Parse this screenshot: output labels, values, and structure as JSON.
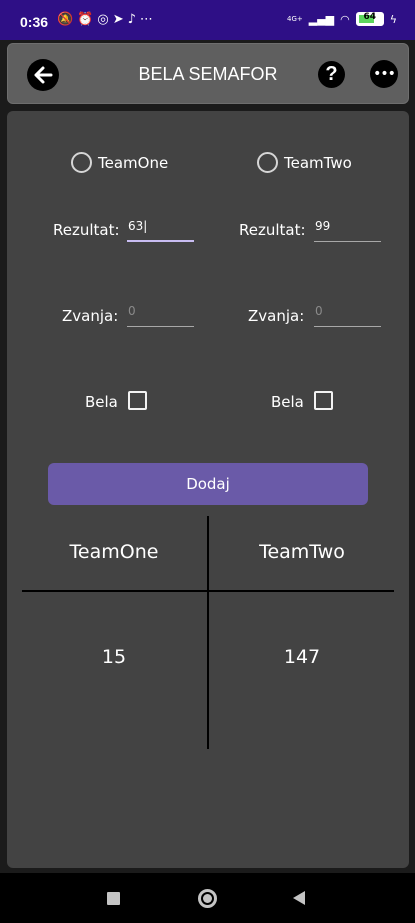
{
  "status_bar": {
    "time": "0:36",
    "icons": [
      "mute-icon",
      "alarm-icon",
      "whatsapp-icon",
      "telegram-icon",
      "notification-icon",
      "more-notifications-icon"
    ],
    "network": "4G+",
    "battery": "64"
  },
  "appbar": {
    "title": "BELA SEMAFOR",
    "help_glyph": "?",
    "more_glyph": "•••"
  },
  "form": {
    "team_one": {
      "name": "TeamOne",
      "rezultat_label": "Rezultat:",
      "rezultat_value": "63",
      "zvanja_label": "Zvanja:",
      "zvanja_placeholder": "0",
      "bela_label": "Bela"
    },
    "team_two": {
      "name": "TeamTwo",
      "rezultat_label": "Rezultat:",
      "rezultat_value": "99",
      "zvanja_label": "Zvanja:",
      "zvanja_placeholder": "0",
      "bela_label": "Bela"
    },
    "add_button": "Dodaj"
  },
  "table": {
    "headers": [
      "TeamOne",
      "TeamTwo"
    ],
    "totals": [
      "15",
      "147"
    ]
  },
  "colors": {
    "status_bar": "#2e0f86",
    "accent": "#6a5aa8",
    "panel": "#434343",
    "appbar": "#5f5f5f"
  }
}
